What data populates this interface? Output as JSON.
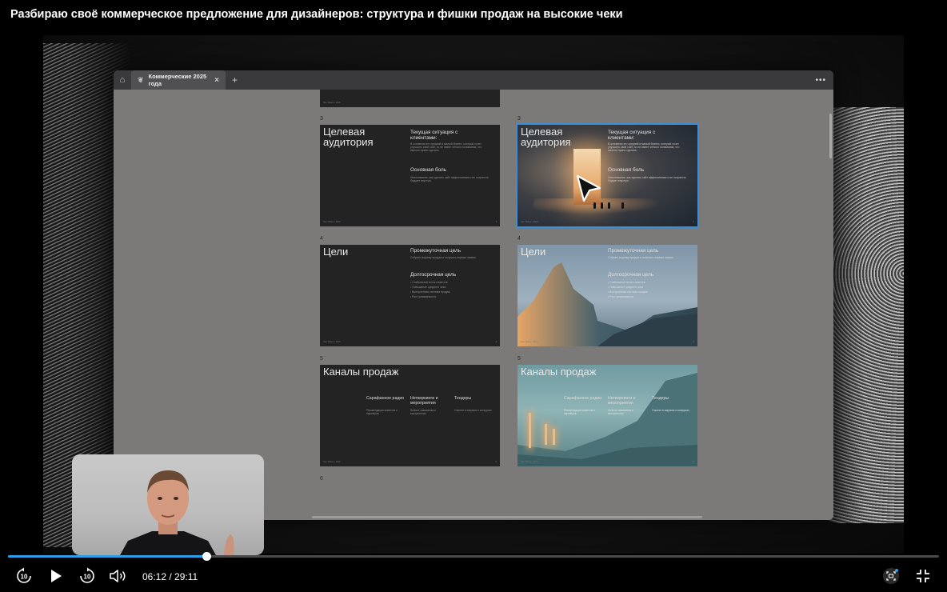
{
  "video_title": "Разбираю своё коммерческое предложение для дизайнеров: структура и фишки продаж на высокие чеки",
  "app": {
    "tab_title": "Коммерческие 2025 года",
    "add_tab": "+",
    "more": "•••"
  },
  "slides": [
    {
      "num": "3",
      "title": "Целевая аудитория",
      "sub1": "Текущая ситуация с клиентами:",
      "body1": "В основном это средний и малый бизнес, который хочет улучшить свой сайт, но не имеет чёткого понимания, что именно нужно сделать.",
      "sub2": "Основная боль",
      "body2": "Непонимание, как сделать сайт эффективным и не потратить бюджет впустую.",
      "footer_left": "Sev Shkov • Web",
      "footer_right": "3"
    },
    {
      "num": "4",
      "title": "Цели",
      "sub1": "Промежуточная цель",
      "body1": "Собрать воронку продаж и получить первые заявки.",
      "sub2": "Долгосрочная цель",
      "bullets": [
        "Стабильный поток клиентов",
        "Повышение среднего чека",
        "Выстроенная система продаж",
        "Рост узнаваемости"
      ],
      "footer_left": "Sev Shkov • Web",
      "footer_right": "4"
    },
    {
      "num": "5",
      "title": "Каналы продаж",
      "columns": [
        {
          "title": "Сарафанное радио",
          "body": "Рекомендации клиентов и партнёров."
        },
        {
          "title": "Нетворкинги и мероприятия",
          "body": "Личные знакомства и выступления."
        },
        {
          "title": "Тендеры",
          "body": "Участие в закупках и конкурсах."
        }
      ],
      "footer_left": "Sev Shkov • Web",
      "footer_right": "5"
    }
  ],
  "next_slide_num": "6",
  "player": {
    "current_time": "06:12",
    "separator": " / ",
    "duration": "29:11",
    "progress_fraction": 0.213,
    "skip_back_label": "10",
    "skip_forward_label": "10",
    "icons": [
      "replay-10-icon",
      "play-icon",
      "forward-10-icon",
      "volume-icon",
      "screenshot-icon",
      "exit-fullscreen-icon"
    ],
    "accent_color": "#2e9ee6"
  }
}
